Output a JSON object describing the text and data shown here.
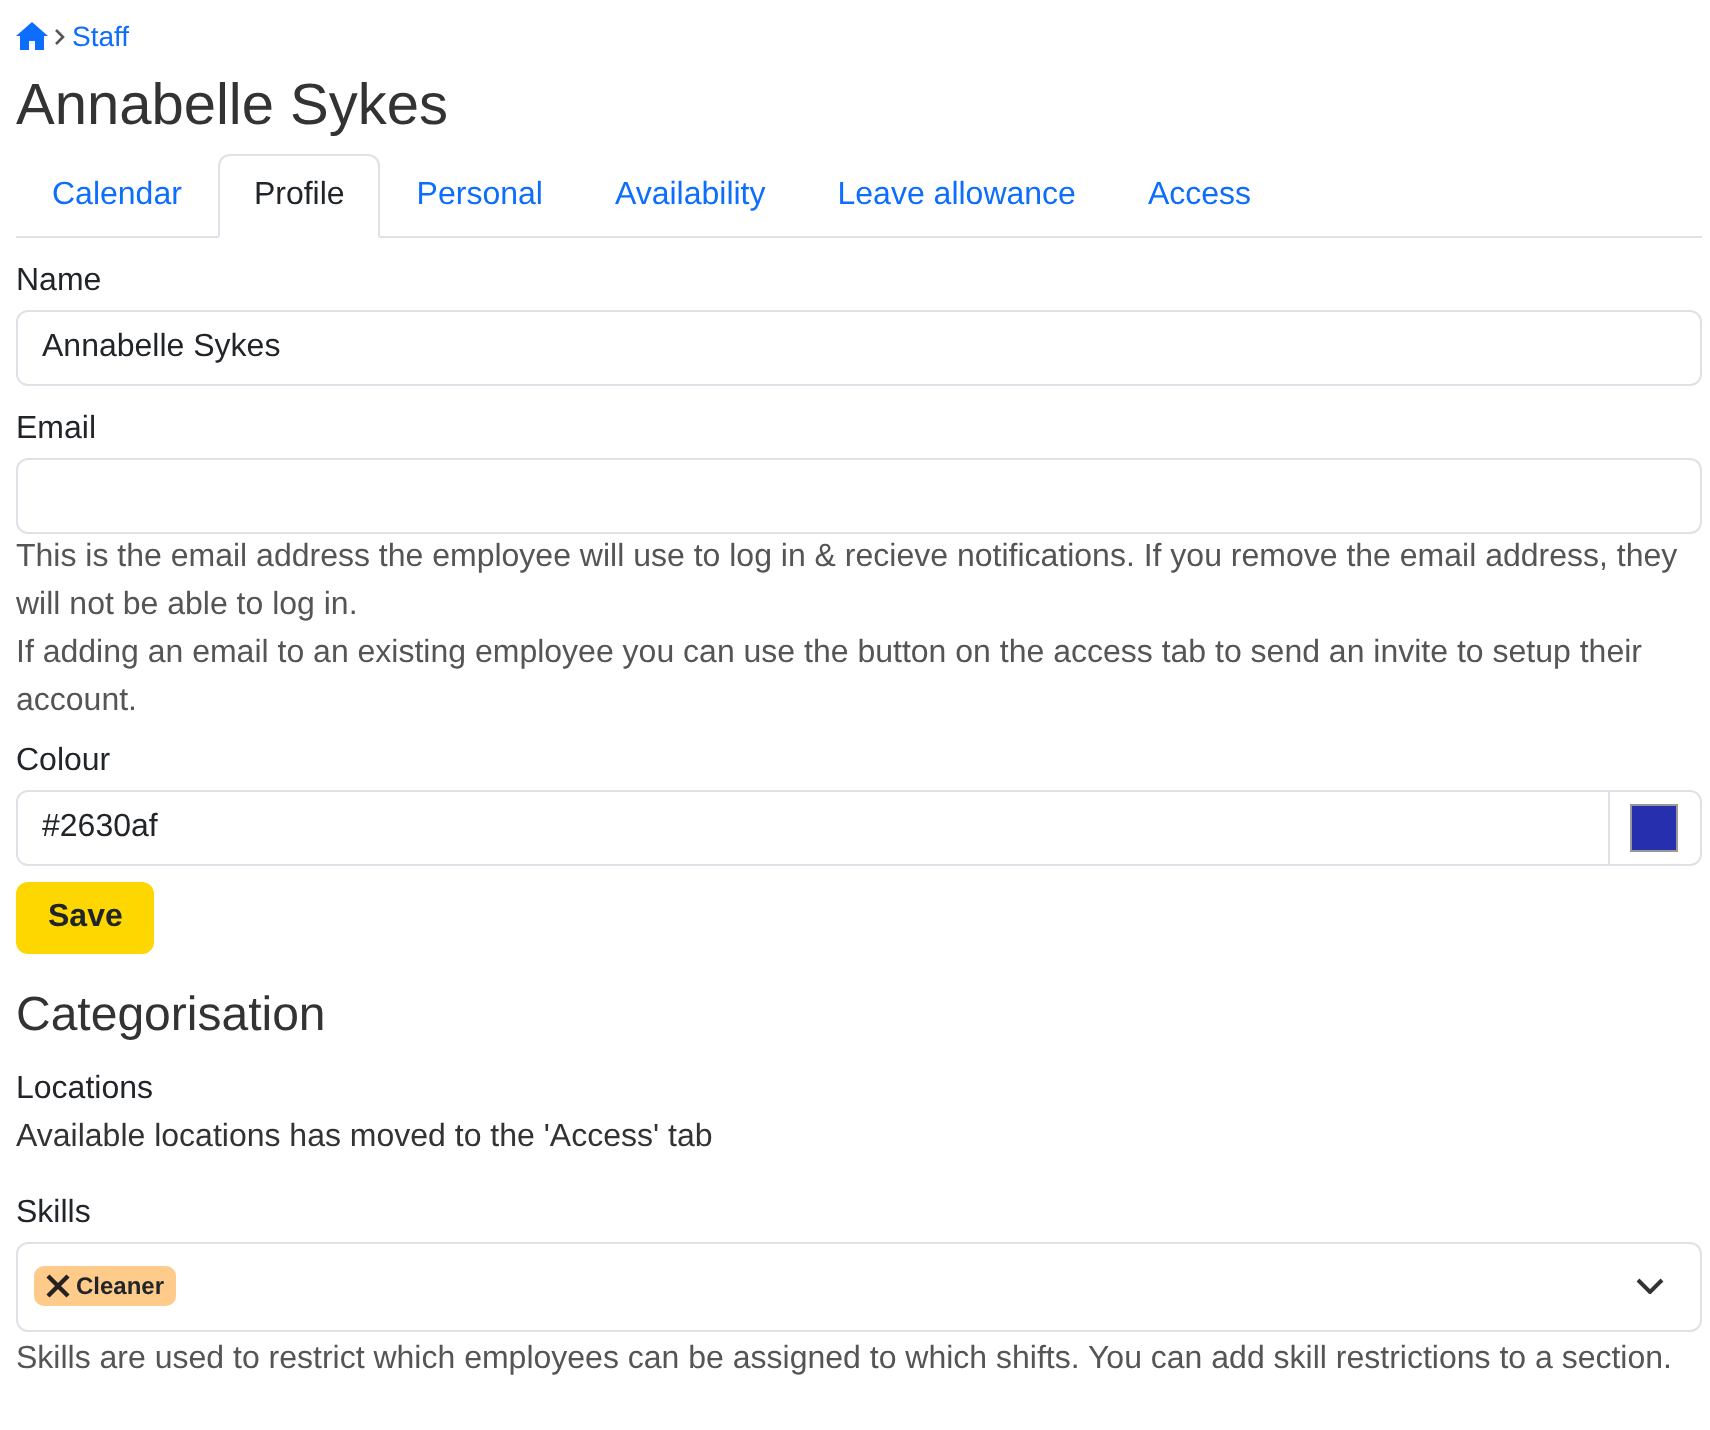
{
  "breadcrumb": {
    "items": [
      "Staff"
    ]
  },
  "title": "Annabelle Sykes",
  "tabs": [
    {
      "label": "Calendar",
      "selected": false
    },
    {
      "label": "Profile",
      "selected": true
    },
    {
      "label": "Personal",
      "selected": false
    },
    {
      "label": "Availability",
      "selected": false
    },
    {
      "label": "Leave allowance",
      "selected": false
    },
    {
      "label": "Access",
      "selected": false
    }
  ],
  "name": {
    "label": "Name",
    "value": "Annabelle Sykes"
  },
  "email": {
    "label": "Email",
    "help": [
      "This is the email address the employee will use to log in & recieve notifications. If you remove the email address, they will not be able to log in.",
      "If adding an email to an existing employee you can use the button on the access tab to send an invite to setup their account."
    ]
  },
  "colour": {
    "label": "Colour",
    "value": "#2630af",
    "color": "#2630af"
  },
  "save_button": "Save",
  "categorisation": {
    "heading": "Categorisation",
    "locations_label": "Locations",
    "locations_text": "Available locations has moved to the 'Access' tab",
    "skills_label": "Skills",
    "skills": [
      {
        "label": "Cleaner",
        "color": "#fecb8b"
      }
    ],
    "skills_help": "Skills are used to restrict which employees can be assigned to which shifts. You can add skill restrictions to a section."
  }
}
